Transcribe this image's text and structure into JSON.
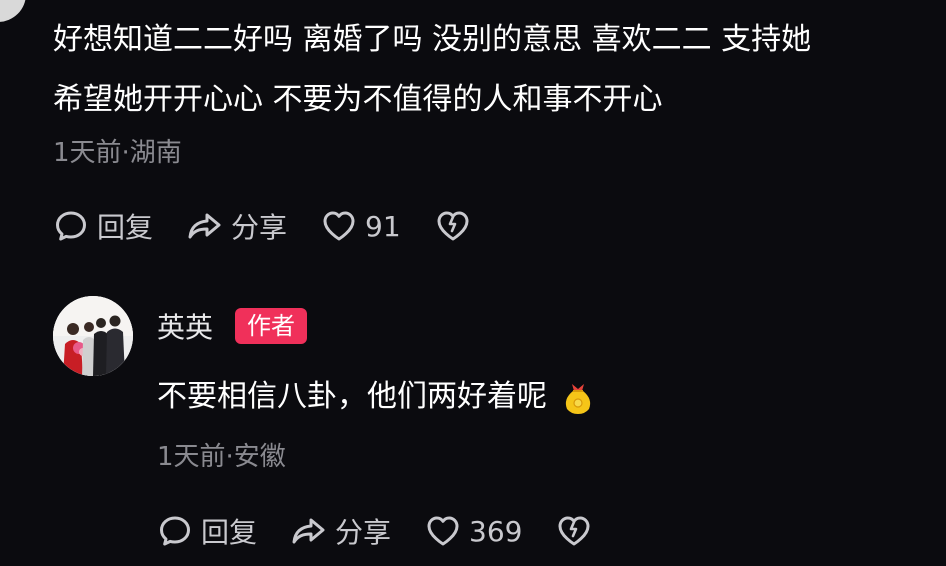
{
  "comment1": {
    "text_line1": "好想知道二二好吗 离婚了吗 没别的意思 喜欢二二 支持她",
    "text_line2": "希望她开开心心 不要为不值得的人和事不开心",
    "meta": "1天前·湖南",
    "reply_label": "回复",
    "share_label": "分享",
    "like_count": "91",
    "icons": [
      "comment-icon",
      "share-icon",
      "heart-icon",
      "broken-heart-icon"
    ]
  },
  "comment2": {
    "author": "英英",
    "badge": "作者",
    "text": "不要相信八卦，他们两好着呢",
    "emoji": "blessing-bag-emoji",
    "meta": "1天前·安徽",
    "reply_label": "回复",
    "share_label": "分享",
    "like_count": "369",
    "icons": [
      "comment-icon",
      "share-icon",
      "heart-icon",
      "broken-heart-icon"
    ]
  },
  "colors": {
    "background": "#0b0b0f",
    "text": "#ffffff",
    "meta": "#8a8a90",
    "action": "#c9c9ce",
    "author_badge": "#f0305a"
  }
}
